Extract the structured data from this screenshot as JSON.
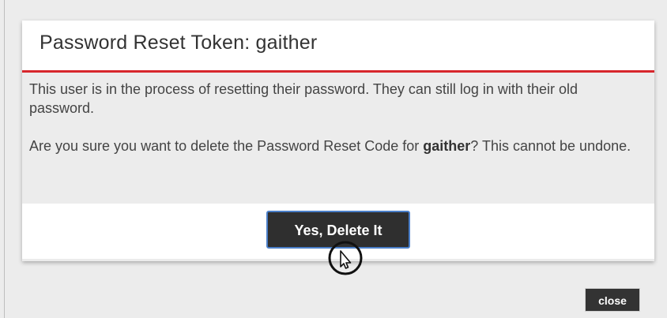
{
  "dialog": {
    "title": "Password Reset Token: gaither",
    "body": {
      "paragraph1": "This user is in the process of resetting their password. They can still log in with their old password.",
      "paragraph2_prefix": "Are you sure you want to delete the Password Reset Code for ",
      "paragraph2_user": "gaither",
      "paragraph2_suffix": "? This cannot be undone."
    },
    "confirm_label": "Yes, Delete It"
  },
  "footer": {
    "close_label": "close"
  },
  "colors": {
    "accent_underline": "#d7262c",
    "button_bg": "#2f2f2f",
    "button_focus_border": "#4a7fc9",
    "background": "#ececec"
  },
  "icons": {
    "cursor": "hand-pointer-icon"
  }
}
